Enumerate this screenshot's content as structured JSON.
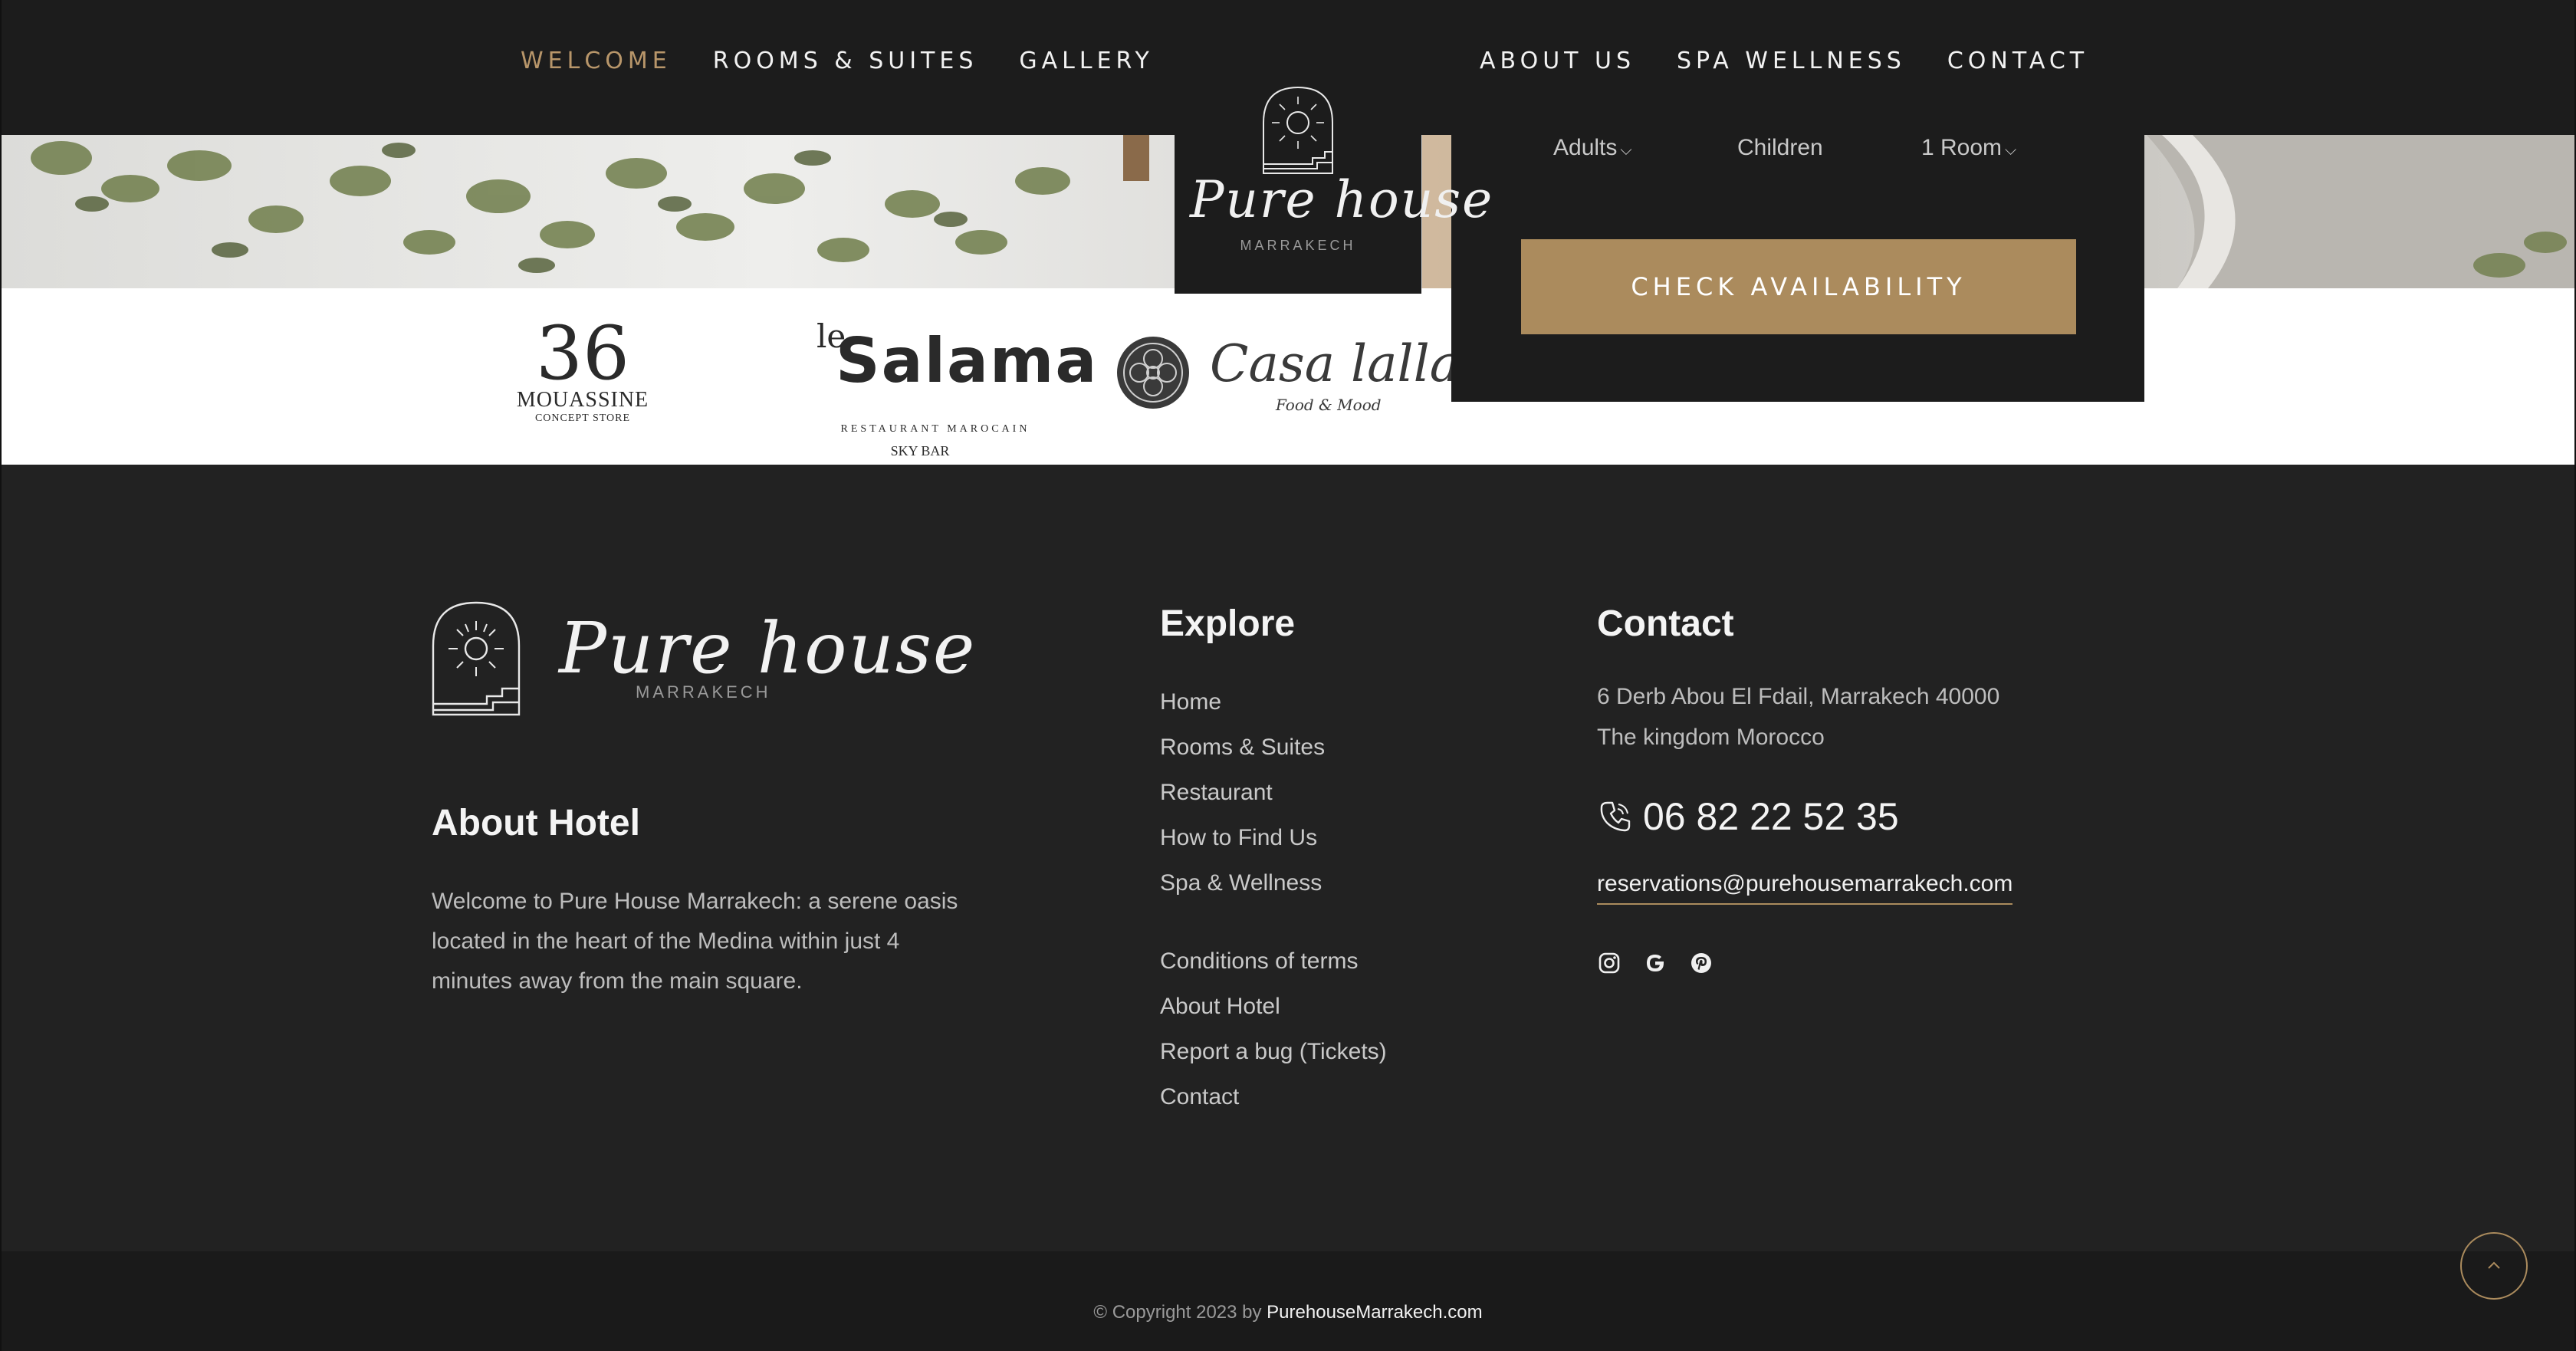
{
  "nav": {
    "left": [
      {
        "label": "WELCOME",
        "active": true
      },
      {
        "label": "ROOMS & SUITES",
        "active": false
      },
      {
        "label": "GALLERY",
        "active": false
      }
    ],
    "right": [
      {
        "label": "ABOUT US"
      },
      {
        "label": "SPA WELLNESS"
      },
      {
        "label": "CONTACT"
      }
    ]
  },
  "brand": {
    "name": "Pure house",
    "city": "MARRAKECH"
  },
  "booking": {
    "adults": "Adults",
    "children": "Children",
    "rooms": "1 Room",
    "cta": "CHECK AVAILABILITY"
  },
  "partners": {
    "mouassine": {
      "mark": "36",
      "name": "MOUASSINE",
      "sub": "CONCEPT STORE"
    },
    "salama": {
      "le": "le",
      "name": "Salama",
      "sub": "RESTAURANT MAROCAIN",
      "bar": "SKY BAR"
    },
    "casa": {
      "name": "Casa lalla",
      "sub": "Food & Mood"
    }
  },
  "footer": {
    "about_title": "About Hotel",
    "about_text": "Welcome to Pure House Marrakech: a serene oasis located in the heart of the Medina within just 4 minutes away from the main square.",
    "explore_title": "Explore",
    "explore_links": [
      "Home",
      "Rooms & Suites",
      "Restaurant",
      "How to Find Us",
      "Spa & Wellness"
    ],
    "explore_links2": [
      "Conditions of terms",
      "About Hotel",
      "Report a bug (Tickets)",
      "Contact"
    ],
    "contact_title": "Contact",
    "address_line1": "6 Derb Abou El Fdail, Marrakech 40000",
    "address_line2": "The kingdom Morocco",
    "phone": "06 82 22 52 35",
    "email": "reservations@purehousemarrakech.com",
    "socials": [
      "instagram-icon",
      "google-icon",
      "pinterest-icon"
    ]
  },
  "copyright": {
    "prefix": "© Copyright 2023 by",
    "site": "PurehouseMarrakech.com"
  },
  "colors": {
    "accent": "#ab8b5d",
    "nav_active": "#b8966a",
    "dark": "#1c1c1c",
    "footer_bg": "#222222"
  }
}
